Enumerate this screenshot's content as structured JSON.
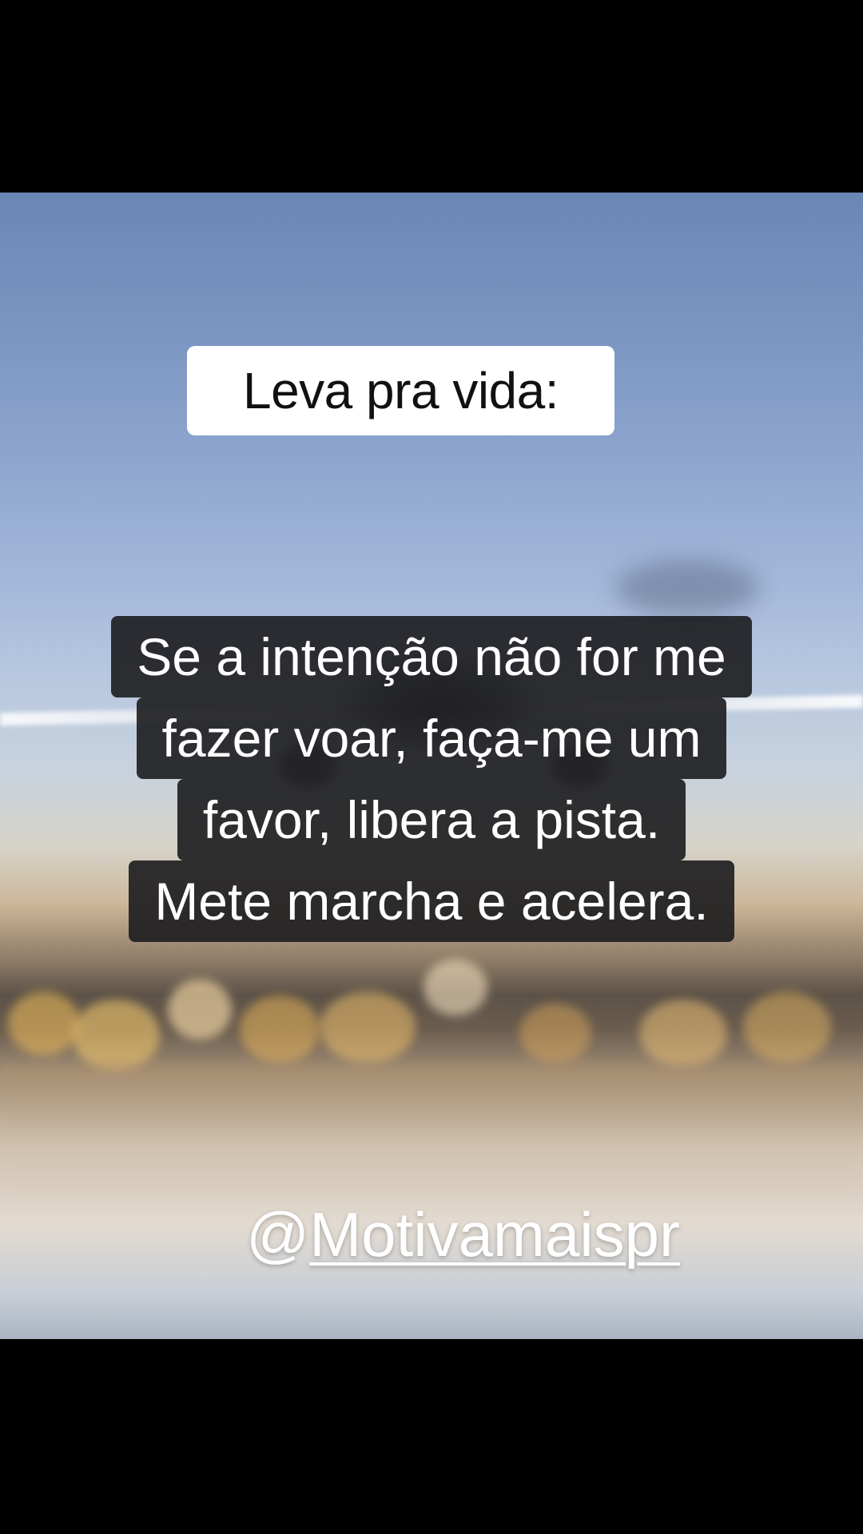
{
  "overlay": {
    "label": "Leva pra vida:",
    "quote_lines": [
      "Se a intenção não for me",
      "fazer voar, faça-me um",
      "favor, libera a pista.",
      "Mete marcha e acelera."
    ],
    "handle_at": "@",
    "handle_name": "Motivamaispr"
  },
  "colors": {
    "label_bg": "#ffffff",
    "label_text": "#111111",
    "quote_bg": "#1c1c1e",
    "quote_text": "#ffffff",
    "letterbox": "#000000"
  }
}
